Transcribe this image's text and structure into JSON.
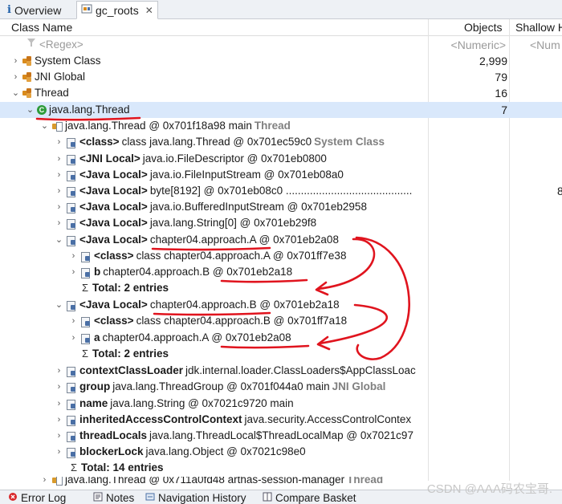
{
  "tabs": [
    {
      "label": "Overview",
      "icon": "info-icon",
      "active": false
    },
    {
      "label": "gc_roots",
      "icon": "gc-roots-icon",
      "active": true,
      "close": "✕"
    }
  ],
  "columns": {
    "class_name": "Class Name",
    "objects": "Objects",
    "shallow": "Shallow H",
    "numeric_filter": "<Numeric>",
    "numeric_filter2": "<Num",
    "regex_filter": "<Regex>"
  },
  "rows": [
    {
      "name": "System Class",
      "objects": "2,999"
    },
    {
      "name": "JNI Global",
      "objects": "79"
    },
    {
      "name": "Thread",
      "objects": "16"
    },
    {
      "name": "java.lang.Thread",
      "objects": "7"
    },
    {
      "name": "java.lang.Thread @ 0x701f18a98  main",
      "tag": "Thread"
    },
    {
      "bold": "<class>",
      "rest": " class java.lang.Thread @ 0x701ec59c0",
      "tag": "System Class"
    },
    {
      "bold": "<JNI Local>",
      "rest": " java.io.FileDescriptor @ 0x701eb0800"
    },
    {
      "bold": "<Java Local>",
      "rest": " java.io.FileInputStream @ 0x701eb08a0"
    },
    {
      "bold": "<Java Local>",
      "rest": " byte[8192] @ 0x701eb08c0  ..........................................",
      "tail": "8"
    },
    {
      "bold": "<Java Local>",
      "rest": " java.io.BufferedInputStream @ 0x701eb2958"
    },
    {
      "bold": "<Java Local>",
      "rest": " java.lang.String[0] @ 0x701eb29f8"
    },
    {
      "bold": "<Java Local>",
      "rest": " chapter04.approach.A @ 0x701eb2a08"
    },
    {
      "bold": "<class>",
      "rest": " class chapter04.approach.A @ 0x701ff7e38"
    },
    {
      "bold": "b",
      "rest": " chapter04.approach.B @ 0x701eb2a18"
    },
    {
      "bold": "Total: 2 entries",
      "rest": ""
    },
    {
      "bold": "<Java Local>",
      "rest": " chapter04.approach.B @ 0x701eb2a18"
    },
    {
      "bold": "<class>",
      "rest": " class chapter04.approach.B @ 0x701ff7a18"
    },
    {
      "bold": "a",
      "rest": " chapter04.approach.A @ 0x701eb2a08"
    },
    {
      "bold": "Total: 2 entries",
      "rest": ""
    },
    {
      "bold": "contextClassLoader",
      "rest": " jdk.internal.loader.ClassLoaders$AppClassLoac"
    },
    {
      "bold": "group",
      "rest": " java.lang.ThreadGroup @ 0x701f044a0  main",
      "tag": "JNI Global"
    },
    {
      "bold": "name",
      "rest": " java.lang.String @ 0x7021c9720  main"
    },
    {
      "bold": "inheritedAccessControlContext",
      "rest": " java.security.AccessControlContex"
    },
    {
      "bold": "threadLocals",
      "rest": " java.lang.ThreadLocal$ThreadLocalMap @ 0x7021c97"
    },
    {
      "bold": "blockerLock",
      "rest": " java.lang.Object @ 0x7021c98e0"
    },
    {
      "bold": "Total: 14 entries",
      "rest": ""
    },
    {
      "name": "java.lang.Thread @ 0x711a0fd48  arthas-session-manager",
      "tag": "Thread"
    }
  ],
  "bottom_tabs": [
    {
      "label": "Error Log",
      "icon": "error-log-icon"
    },
    {
      "label": "Notes",
      "icon": "notes-icon"
    },
    {
      "label": "Navigation History",
      "icon": "navigation-history-icon"
    },
    {
      "label": "Compare Basket",
      "icon": "compare-basket-icon"
    }
  ],
  "watermark": "CSDN @AAA码农宝哥.",
  "colors": {
    "tab_bg": "#eef1f5",
    "selection": "#d9e8fb",
    "annotation": "#e0141e",
    "tag_gray": "#808080"
  }
}
